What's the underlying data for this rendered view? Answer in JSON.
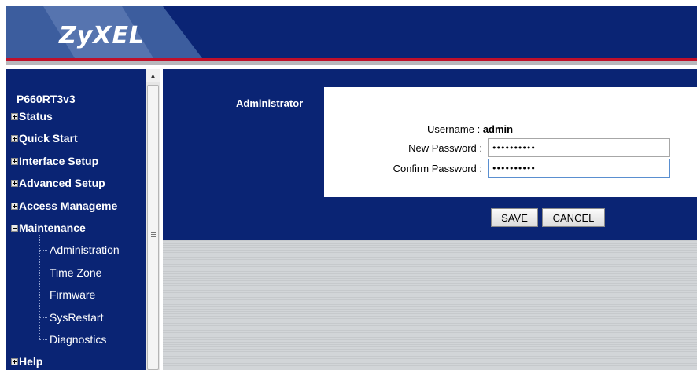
{
  "header": {
    "logo_text": "ZyXEL",
    "colors": {
      "navy": "#0a2474",
      "accent_red": "#c0102a"
    }
  },
  "sidebar": {
    "device_name": "P660RT3v3",
    "items": [
      {
        "label": "Status",
        "icon": "plus-box-icon"
      },
      {
        "label": "Quick Start",
        "icon": "plus-box-icon"
      },
      {
        "label": "Interface Setup",
        "icon": "plus-box-icon"
      },
      {
        "label": "Advanced Setup",
        "icon": "plus-box-icon"
      },
      {
        "label": "Access Manageme",
        "icon": "plus-box-icon"
      },
      {
        "label": "Maintenance",
        "icon": "minus-box-icon",
        "expanded": true
      },
      {
        "label": "Help",
        "icon": "plus-box-icon"
      }
    ],
    "maintenance_children": [
      "Administration",
      "Time Zone",
      "Firmware",
      "SysRestart",
      "Diagnostics"
    ]
  },
  "main": {
    "section_title": "Administrator",
    "username_label": "Username :",
    "username_value": "admin",
    "new_password_label": "New Password :",
    "new_password_value": "••••••••••",
    "confirm_password_label": "Confirm Password :",
    "confirm_password_value": "••••••••••",
    "save_label": "SAVE",
    "cancel_label": "CANCEL"
  }
}
